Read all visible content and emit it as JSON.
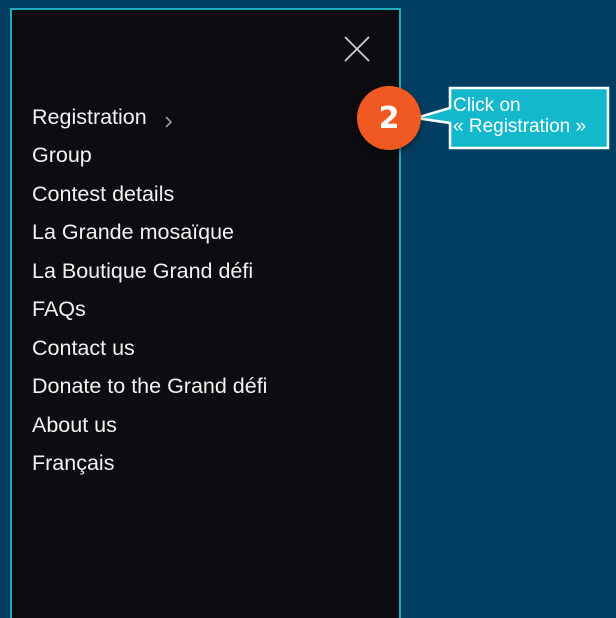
{
  "menu": {
    "close_icon": "close-x-icon",
    "chevron_icon": "chevron-right-icon",
    "items": [
      {
        "label": "Registration",
        "has_submenu": true
      },
      {
        "label": "Group"
      },
      {
        "label": "Contest details"
      },
      {
        "label": "La Grande mosaïque"
      },
      {
        "label": "La Boutique Grand défi"
      },
      {
        "label": "FAQs"
      },
      {
        "label": "Contact us"
      },
      {
        "label": "Donate to the Grand défi"
      },
      {
        "label": "About us"
      },
      {
        "label": "Français"
      }
    ]
  },
  "callout": {
    "step_number": "2",
    "line1": "Click on",
    "line2": "« Registration »",
    "badge_color": "#f05a22",
    "box_color": "#14b8cc"
  },
  "colors": {
    "background": "#033f62",
    "panel": "#0d0c10",
    "panel_border": "#1aaebf"
  }
}
